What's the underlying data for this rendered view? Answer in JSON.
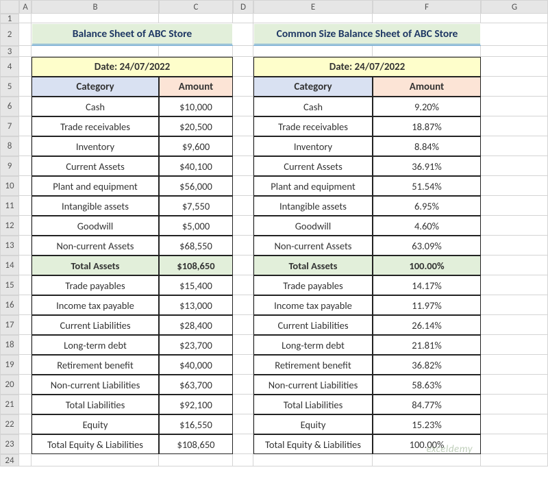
{
  "columns": [
    "A",
    "B",
    "C",
    "D",
    "E",
    "F",
    "G"
  ],
  "row_count": 24,
  "left": {
    "title": "Balance Sheet of ABC Store",
    "date": "Date: 24/07/2022",
    "hdr_cat": "Category",
    "hdr_amt": "Amount",
    "rows": [
      {
        "cat": "Cash",
        "amt": "$10,000"
      },
      {
        "cat": "Trade receivables",
        "amt": "$20,500"
      },
      {
        "cat": "Inventory",
        "amt": "$9,600"
      },
      {
        "cat": "Current Assets",
        "amt": "$40,100"
      },
      {
        "cat": "Plant and equipment",
        "amt": "$56,000"
      },
      {
        "cat": "Intangible assets",
        "amt": "$7,550"
      },
      {
        "cat": "Goodwill",
        "amt": "$5,000"
      },
      {
        "cat": "Non-current Assets",
        "amt": "$68,550"
      },
      {
        "cat": "Total Assets",
        "amt": "$108,650",
        "total": true
      },
      {
        "cat": "Trade payables",
        "amt": "$15,400"
      },
      {
        "cat": "Income tax payable",
        "amt": "$13,000"
      },
      {
        "cat": "Current Liabilities",
        "amt": "$28,400"
      },
      {
        "cat": "Long-term debt",
        "amt": "$23,700"
      },
      {
        "cat": "Retirement benefit",
        "amt": "$40,000"
      },
      {
        "cat": "Non-current Liabilities",
        "amt": "$63,700"
      },
      {
        "cat": "Total Liabilities",
        "amt": "$92,100"
      },
      {
        "cat": "Equity",
        "amt": "$16,550"
      },
      {
        "cat": "Total Equity & Liabilities",
        "amt": "$108,650"
      }
    ]
  },
  "right": {
    "title": "Common Size Balance Sheet of ABC Store",
    "date": "Date: 24/07/2022",
    "hdr_cat": "Category",
    "hdr_amt": "Amount",
    "rows": [
      {
        "cat": "Cash",
        "amt": "9.20%"
      },
      {
        "cat": "Trade receivables",
        "amt": "18.87%"
      },
      {
        "cat": "Inventory",
        "amt": "8.84%"
      },
      {
        "cat": "Current Assets",
        "amt": "36.91%"
      },
      {
        "cat": "Plant and equipment",
        "amt": "51.54%"
      },
      {
        "cat": "Intangible assets",
        "amt": "6.95%"
      },
      {
        "cat": "Goodwill",
        "amt": "4.60%"
      },
      {
        "cat": "Non-current Assets",
        "amt": "63.09%"
      },
      {
        "cat": "Total Assets",
        "amt": "100.00%",
        "total": true
      },
      {
        "cat": "Trade payables",
        "amt": "14.17%"
      },
      {
        "cat": "Income tax payable",
        "amt": "11.97%"
      },
      {
        "cat": "Current Liabilities",
        "amt": "26.14%"
      },
      {
        "cat": "Long-term debt",
        "amt": "21.81%"
      },
      {
        "cat": "Retirement benefit",
        "amt": "36.82%"
      },
      {
        "cat": "Non-current Liabilities",
        "amt": "58.63%"
      },
      {
        "cat": "Total Liabilities",
        "amt": "84.77%"
      },
      {
        "cat": "Equity",
        "amt": "15.23%"
      },
      {
        "cat": "Total Equity & Liabilities",
        "amt": "100.00%"
      }
    ]
  },
  "watermark": "exceldemy"
}
